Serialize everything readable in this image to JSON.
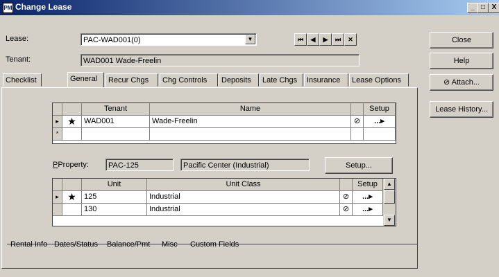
{
  "window": {
    "title": "Change Lease",
    "app_icon_text": "PM",
    "min": "_",
    "max": "□",
    "close": "X"
  },
  "lease": {
    "label": "Lease:",
    "value": "PAC-WAD001(0)"
  },
  "tenant": {
    "label": "Tenant:",
    "value": "WAD001  Wade-Freelin"
  },
  "nav": {
    "first": "⏮",
    "prev": "◀",
    "next": "▶",
    "last": "⏭",
    "clear": "✕"
  },
  "side_buttons": {
    "close": "Close",
    "help": "Help",
    "attach": "Attach...",
    "lease_history": "Lease History..."
  },
  "tabs": [
    "Checklist",
    "General",
    "Recur Chgs",
    "Chg Controls",
    "Deposits",
    "Late Chgs",
    "Insurance",
    "Lease Options"
  ],
  "tenant_grid": {
    "headers": {
      "tenant": "Tenant",
      "name": "Name",
      "setup": "Setup"
    },
    "rows": [
      {
        "marker": "▸",
        "star": "★",
        "tenant": "WAD001",
        "name": "Wade-Freelin",
        "clip": "⊘",
        "setup": "...▸"
      }
    ],
    "new_row_marker": "*"
  },
  "property": {
    "label": "Property:",
    "code": "PAC-125",
    "name": "Pacific Center (Industrial)",
    "setup_button": "Setup..."
  },
  "unit_grid": {
    "headers": {
      "unit": "Unit",
      "unit_class": "Unit Class",
      "setup": "Setup"
    },
    "rows": [
      {
        "marker": "▸",
        "star": "★",
        "unit": "125",
        "unit_class": "Industrial",
        "clip": "⊘",
        "setup": "...▸"
      },
      {
        "marker": "",
        "star": "",
        "unit": "130",
        "unit_class": "Industrial",
        "clip": "⊘",
        "setup": "...▸"
      }
    ]
  },
  "bottom_tabs": [
    "Rental Info",
    "Dates/Status",
    "Balance/Pmt",
    "Misc",
    "Custom Fields"
  ]
}
